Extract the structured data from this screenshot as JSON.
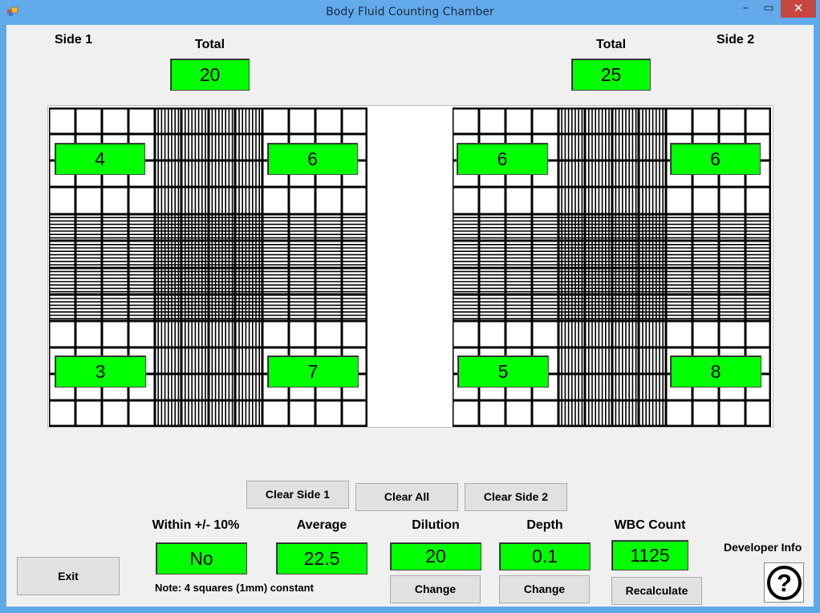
{
  "window": {
    "title": "Body Fluid Counting Chamber",
    "min": "–",
    "max": "▭",
    "close": "✕"
  },
  "side1": {
    "label": "Side 1",
    "total_label": "Total",
    "total": "20",
    "counts": [
      "4",
      "6",
      "3",
      "7"
    ]
  },
  "side2": {
    "label": "Side 2",
    "total_label": "Total",
    "total": "25",
    "counts": [
      "6",
      "6",
      "5",
      "8"
    ]
  },
  "buttons": {
    "clear_side1": "Clear Side 1",
    "clear_all": "Clear All",
    "clear_side2": "Clear Side 2",
    "exit": "Exit",
    "change_dilution": "Change",
    "change_depth": "Change",
    "recalculate": "Recalculate"
  },
  "results": {
    "within_label": "Within +/- 10%",
    "within_value": "No",
    "average_label": "Average",
    "average_value": "22.5",
    "dilution_label": "Dilution",
    "dilution_value": "20",
    "depth_label": "Depth",
    "depth_value": "0.1",
    "wbc_label": "WBC Count",
    "wbc_value": "1125"
  },
  "note": "Note: 4 squares (1mm) constant",
  "developer_info": "Developer Info",
  "help_glyph": "?",
  "colors": {
    "count_box": "#00ff00",
    "title_bar": "#62aaea",
    "close_button": "#c7463f"
  }
}
